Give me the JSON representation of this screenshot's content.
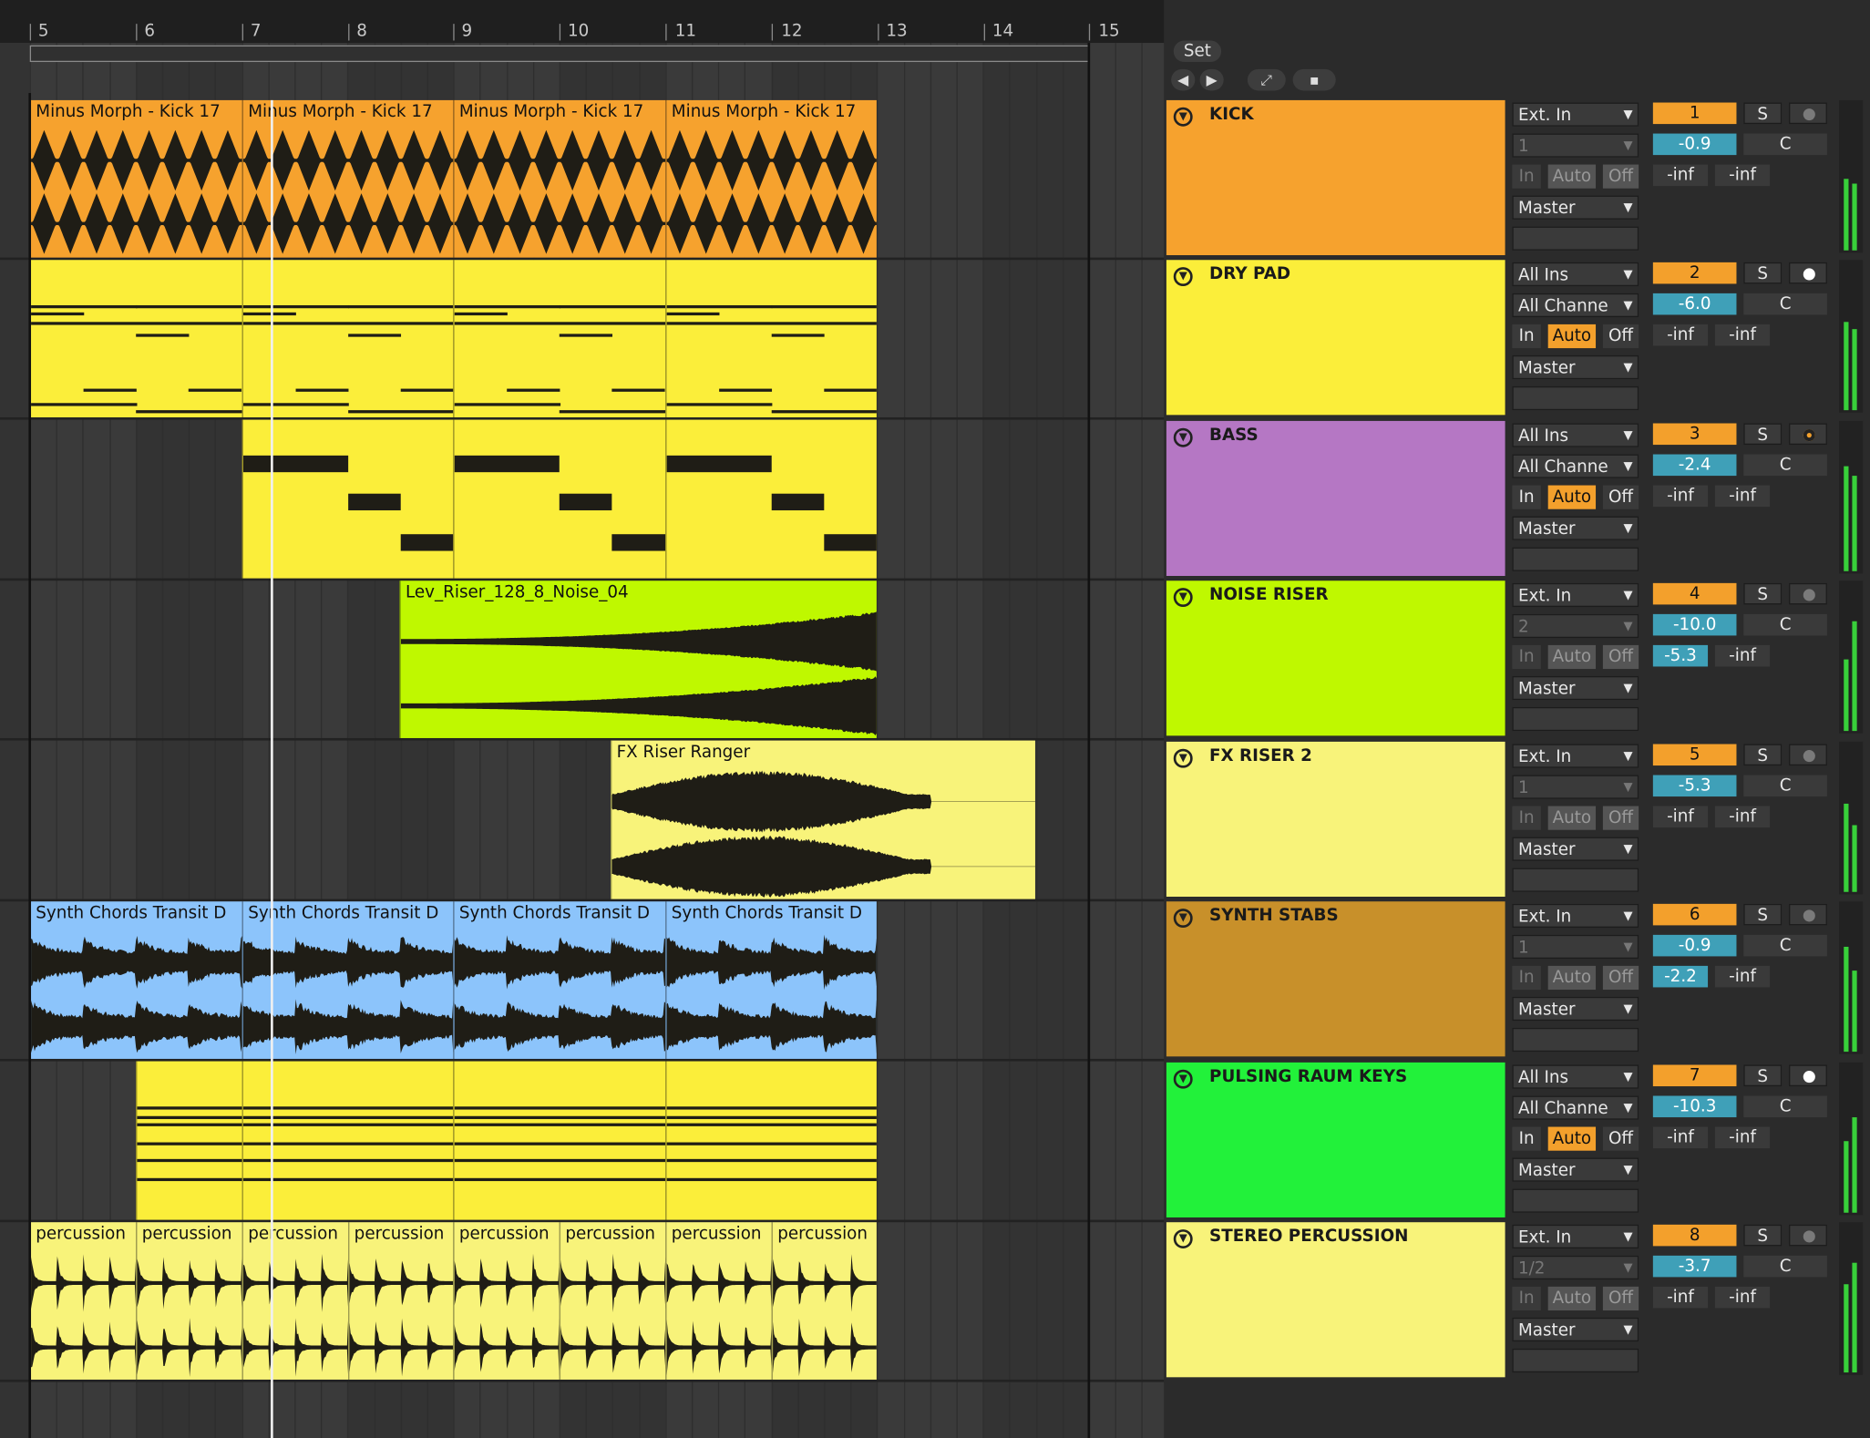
{
  "ruler": {
    "bars": [
      "5",
      "6",
      "7",
      "8",
      "9",
      "10",
      "11",
      "12",
      "13",
      "14",
      "15"
    ]
  },
  "session": {
    "set_label": "Set"
  },
  "colors": {
    "kick": "#f6a22e",
    "dry_pad": "#fbee3a",
    "bass": "#b577c4",
    "noise_riser": "#bff800",
    "fx_riser": "#f8f37a",
    "synth_stabs": "#c8902a",
    "pulsing_keys": "#22f13a",
    "stereo_perc": "#f8f37a",
    "clip_yellow": "#fbee3a",
    "clip_blue": "#8cc4fb"
  },
  "clips": {
    "kick": [
      "Minus Morph - Kick 17",
      "Minus Morph - Kick 17",
      "Minus Morph - Kick 17",
      "Minus Morph - Kick 17"
    ],
    "noise": "Lev_Riser_128_8_Noise_04",
    "fx": "FX Riser Ranger",
    "synth": [
      "Synth Chords Transit D",
      "Synth Chords Transit D",
      "Synth Chords Transit D",
      "Synth Chords Transit D"
    ],
    "perc": [
      "percussion",
      "percussion",
      "percussion",
      "percussion",
      "percussion",
      "percussion",
      "percussion",
      "percussion"
    ]
  },
  "tracks": [
    {
      "name": "KICK",
      "input": "Ext. In",
      "channel": "1",
      "output": "Master",
      "number": "1",
      "volume": "-0.9",
      "send_l": "-inf",
      "send_r": "-inf",
      "monitor": "Off",
      "arm": "dim"
    },
    {
      "name": "DRY PAD",
      "input": "All Ins",
      "channel": "All Channe",
      "output": "Master",
      "number": "2",
      "volume": "-6.0",
      "send_l": "-inf",
      "send_r": "-inf",
      "monitor": "Auto",
      "arm": "on"
    },
    {
      "name": "BASS",
      "input": "All Ins",
      "channel": "All Channe",
      "output": "Master",
      "number": "3",
      "volume": "-2.4",
      "send_l": "-inf",
      "send_r": "-inf",
      "monitor": "Auto",
      "arm": "rec"
    },
    {
      "name": "NOISE RISER",
      "input": "Ext. In",
      "channel": "2",
      "output": "Master",
      "number": "4",
      "volume": "-10.0",
      "send_l": "-5.3",
      "send_r": "-inf",
      "monitor": "Off",
      "arm": "dim"
    },
    {
      "name": "FX RISER 2",
      "input": "Ext. In",
      "channel": "1",
      "output": "Master",
      "number": "5",
      "volume": "-5.3",
      "send_l": "-inf",
      "send_r": "-inf",
      "monitor": "Off",
      "arm": "dim"
    },
    {
      "name": "SYNTH STABS",
      "input": "Ext. In",
      "channel": "1",
      "output": "Master",
      "number": "6",
      "volume": "-0.9",
      "send_l": "-2.2",
      "send_r": "-inf",
      "monitor": "Off",
      "arm": "dim"
    },
    {
      "name": "PULSING RAUM KEYS",
      "input": "All Ins",
      "channel": "All Channe",
      "output": "Master",
      "number": "7",
      "volume": "-10.3",
      "send_l": "-inf",
      "send_r": "-inf",
      "monitor": "Auto",
      "arm": "on"
    },
    {
      "name": "STEREO PERCUSSION",
      "input": "Ext. In",
      "channel": "1/2",
      "output": "Master",
      "number": "8",
      "volume": "-3.7",
      "send_l": "-inf",
      "send_r": "-inf",
      "monitor": "Off",
      "arm": "dim"
    }
  ],
  "labels": {
    "in": "In",
    "auto": "Auto",
    "off": "Off",
    "solo": "S",
    "crossfade": "C"
  },
  "icons": {
    "back": "arrow-left-icon",
    "forward": "arrow-right-icon",
    "expand": "expand-icon",
    "lock": "lock-icon",
    "fold": "fold-triangle-icon"
  }
}
